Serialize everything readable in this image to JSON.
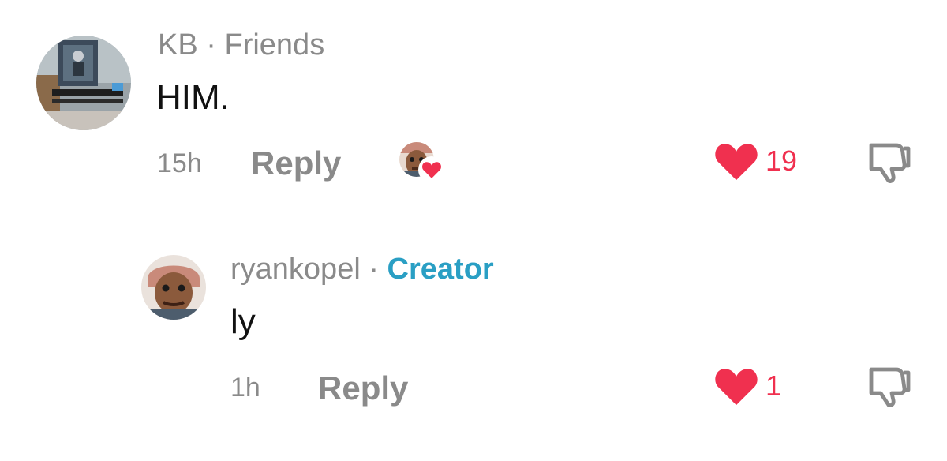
{
  "comments": [
    {
      "username": "KB",
      "separator": "·",
      "tag": "Friends",
      "text": "HIM.",
      "time": "15h",
      "reply_label": "Reply",
      "liked_by_creator": true,
      "like_count": "19"
    },
    {
      "username": "ryankopel",
      "separator": "·",
      "tag": "Creator",
      "text": "ly",
      "time": "1h",
      "reply_label": "Reply",
      "liked_by_creator": false,
      "like_count": "1"
    }
  ],
  "colors": {
    "like_red": "#f0304f",
    "creator_blue": "#2a9fc4",
    "muted_gray": "#8a8a8a",
    "text": "#111111"
  },
  "icons": [
    "heart-icon",
    "thumbs-down-icon",
    "creator-liked-heart-icon"
  ]
}
